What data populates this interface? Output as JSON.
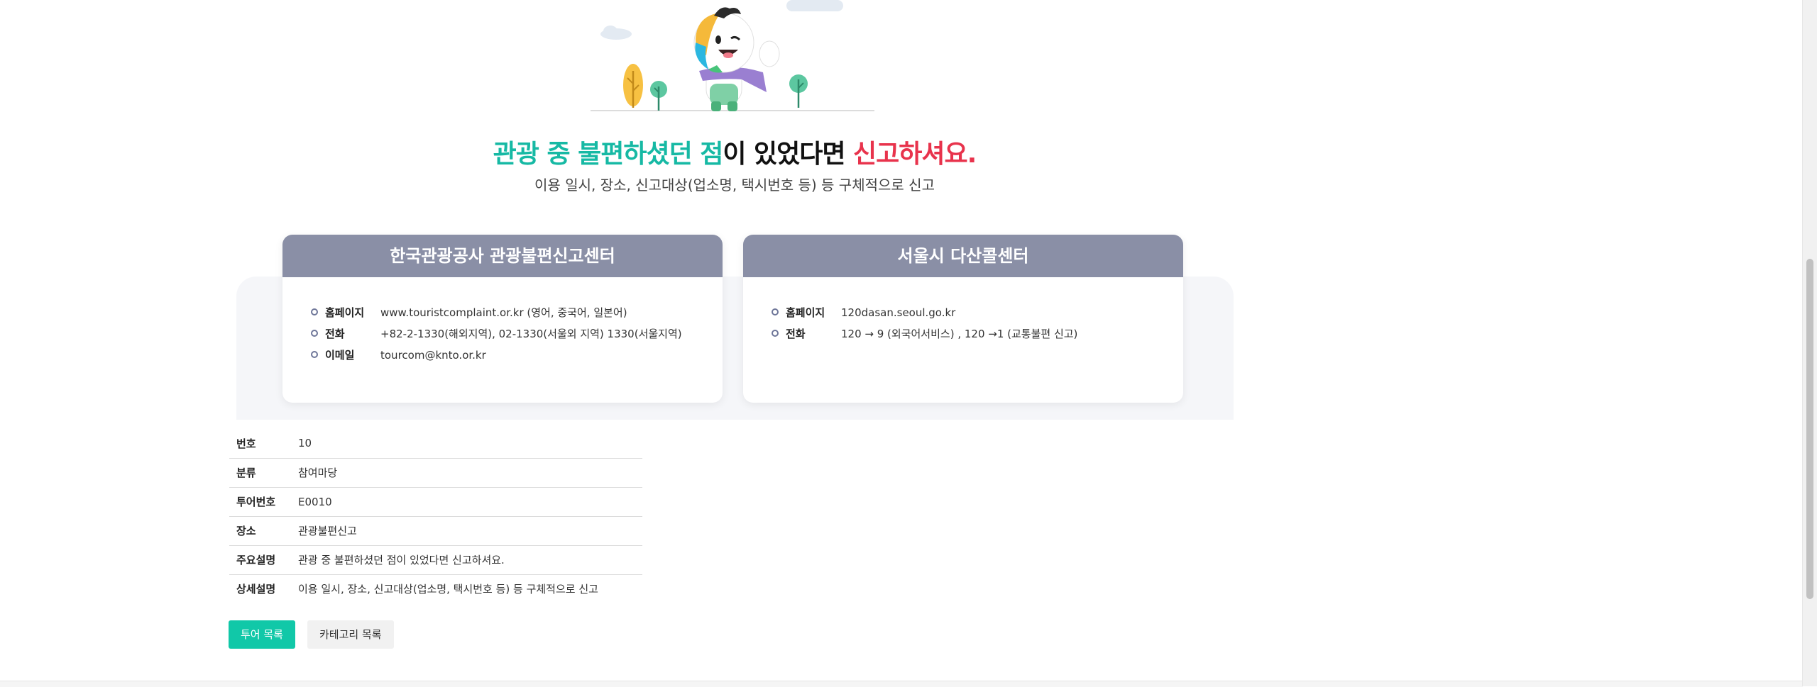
{
  "headline": {
    "part1": "관광 중 불편하셨던 점",
    "part2": "이 있었다면 ",
    "part3": "신고하셔요."
  },
  "subheadline": "이용 일시, 장소, 신고대상(업소명, 택시번호 등) 등 구체적으로 신고",
  "cards": [
    {
      "title": "한국관광공사 관광불편신고센터",
      "rows": [
        {
          "label": "홈페이지",
          "value": "www.touristcomplaint.or.kr (영어, 중국어, 일본어)"
        },
        {
          "label": "전화",
          "value": "+82-2-1330(해외지역), 02-1330(서울외 지역) 1330(서울지역)"
        },
        {
          "label": "이메일",
          "value": "tourcom@knto.or.kr"
        }
      ]
    },
    {
      "title": "서울시 다산콜센터",
      "rows": [
        {
          "label": "홈페이지",
          "value": "120dasan.seoul.go.kr"
        },
        {
          "label": "전화",
          "value": "120 → 9 (외국어서비스) , 120 →1 (교통불편 신고)"
        }
      ]
    }
  ],
  "info": [
    {
      "label": "번호",
      "value": "10"
    },
    {
      "label": "분류",
      "value": "참여마당"
    },
    {
      "label": "투어번호",
      "value": "E0010"
    },
    {
      "label": "장소",
      "value": "관광불편신고"
    },
    {
      "label": "주요설명",
      "value": "관광 중 불편하셨던 점이 있었다면 신고하셔요."
    },
    {
      "label": "상세설명",
      "value": "이용 일시, 장소, 신고대상(업소명, 택시번호 등) 등 구체적으로 신고"
    }
  ],
  "buttons": {
    "tour_list": "투어 목록",
    "category_list": "카테고리 목록"
  },
  "colors": {
    "accent_teal": "#16b9a4",
    "accent_red": "#e8334c",
    "card_header": "#8a8fa6",
    "button_primary": "#11c8a8"
  }
}
